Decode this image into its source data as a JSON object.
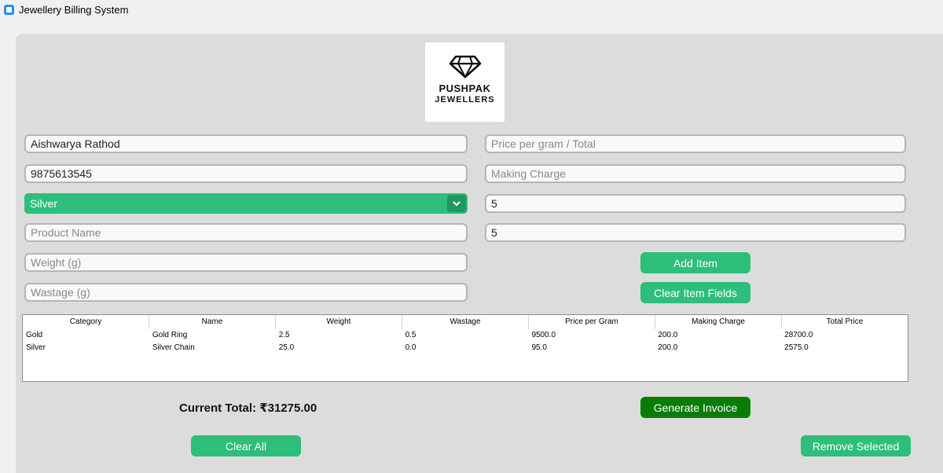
{
  "window": {
    "title": "Jewellery Billing System"
  },
  "logo": {
    "line1": "PUSHPAK",
    "line2": "JEWELLERS",
    "icon": "diamond-icon"
  },
  "form": {
    "customer_name": {
      "value": "Aishwarya Rathod",
      "placeholder": ""
    },
    "phone": {
      "value": "9875613545",
      "placeholder": ""
    },
    "category_select": {
      "value": "Silver",
      "options_visible": [
        "Silver"
      ]
    },
    "product_name": {
      "value": "",
      "placeholder": "Product Name"
    },
    "weight": {
      "value": "",
      "placeholder": "Weight (g)"
    },
    "wastage": {
      "value": "",
      "placeholder": "Wastage (g)"
    },
    "price_per_gram": {
      "value": "",
      "placeholder": "Price per gram / Total"
    },
    "making_charge": {
      "value": "",
      "placeholder": "Making Charge"
    },
    "field_a": {
      "value": "5"
    },
    "field_b": {
      "value": "5"
    }
  },
  "buttons": {
    "add_item": "Add Item",
    "clear_item_fields": "Clear Item Fields",
    "generate_invoice": "Generate Invoice",
    "clear_all": "Clear All",
    "remove_selected": "Remove Selected"
  },
  "table": {
    "columns": [
      "Category",
      "Name",
      "Weight",
      "Wastage",
      "Price per Gram",
      "Making Charge",
      "Total Price"
    ],
    "rows": [
      [
        "Gold",
        "Gold Ring",
        "2.5",
        "0.5",
        "9500.0",
        "200.0",
        "28700.0"
      ],
      [
        "Silver",
        "Silver Chain",
        "25.0",
        "0.0",
        "95.0",
        "200.0",
        "2575.0"
      ]
    ]
  },
  "summary": {
    "current_total": "Current Total: ₹31275.00"
  },
  "colors": {
    "accent": "#2dbe7a",
    "accent_dark": "#077d07",
    "panel": "#dcdcdc"
  }
}
